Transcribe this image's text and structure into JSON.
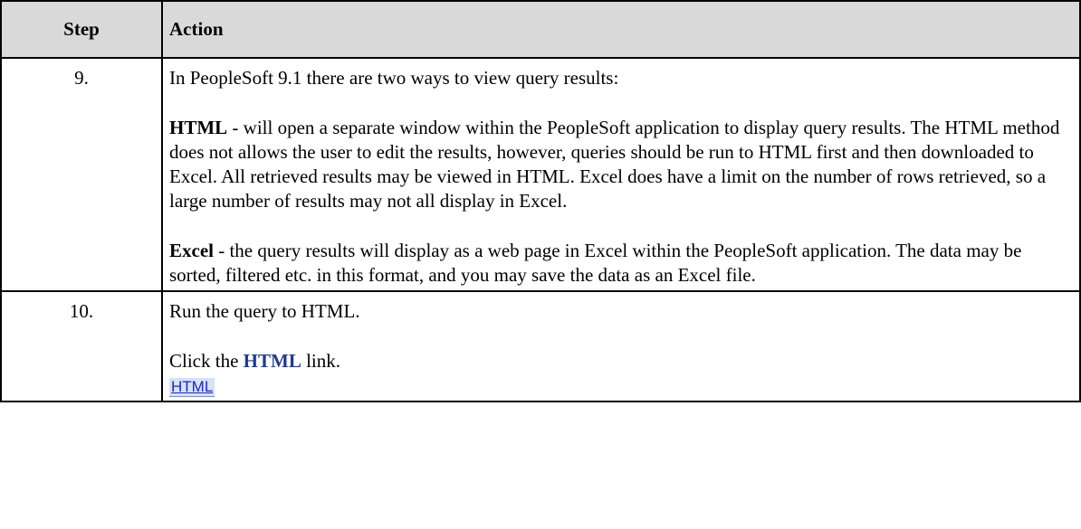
{
  "table": {
    "header": {
      "step": "Step",
      "action": "Action"
    },
    "rows": [
      {
        "step": "9.",
        "intro": "In PeopleSoft 9.1 there are two  ways to view query results:",
        "html_term": "HTML",
        "html_text": " - will open a separate window within the PeopleSoft application to display query results. The HTML method does not allows the user to edit the results, however, queries should be run to HTML first and then downloaded to Excel. All retrieved results may be viewed in HTML. Excel does have a limit on the number of rows retrieved, so a large number of results may not all display in Excel.",
        "excel_term": "Excel",
        "excel_text": " - the query results will display as a web page in Excel within the PeopleSoft application. The data may be sorted, filtered etc. in this format, and you may save the data as an Excel file."
      },
      {
        "step": "10.",
        "intro": "Run the query to HTML.",
        "click_prefix": "Click the ",
        "click_link": "HTML",
        "click_suffix": " link.",
        "link_image_label": "HTML"
      }
    ]
  },
  "colors": {
    "header_background": "#d9d9d9",
    "link_text": "#1f3a93",
    "link_image_text": "#1a27c9",
    "link_image_background": "#d8e1f5"
  }
}
